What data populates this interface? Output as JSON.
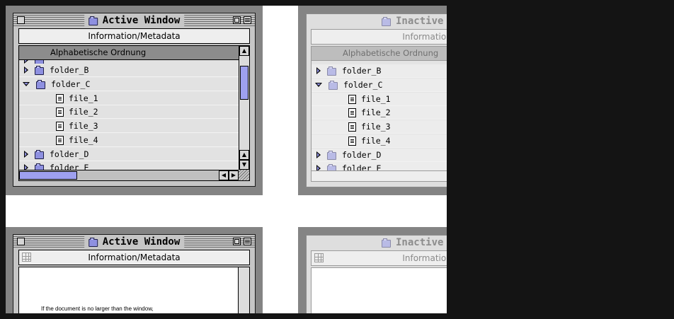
{
  "windows": {
    "active": {
      "title": "Active Window",
      "info_label": "Information/Metadata",
      "column_header": "Alphabetische Ordnung",
      "rows": [
        {
          "type": "folder",
          "label": "folder_B",
          "expanded": false
        },
        {
          "type": "folder",
          "label": "folder_C",
          "expanded": true
        },
        {
          "type": "file",
          "label": "file_1"
        },
        {
          "type": "file",
          "label": "file_2"
        },
        {
          "type": "file",
          "label": "file_3"
        },
        {
          "type": "file",
          "label": "file_4"
        },
        {
          "type": "folder",
          "label": "folder_D",
          "expanded": false
        },
        {
          "type": "folder",
          "label": "folder_E",
          "expanded": false
        }
      ]
    },
    "inactive": {
      "title": "Inactive Wi",
      "info_label": "Information/Meta",
      "column_header": "Alphabetische Ordnung",
      "rows": [
        {
          "type": "folder",
          "label": "folder_B",
          "expanded": false
        },
        {
          "type": "folder",
          "label": "folder_C",
          "expanded": true
        },
        {
          "type": "file",
          "label": "file_1"
        },
        {
          "type": "file",
          "label": "file_2"
        },
        {
          "type": "file",
          "label": "file_3"
        },
        {
          "type": "file",
          "label": "file_4"
        },
        {
          "type": "folder",
          "label": "folder_D",
          "expanded": false
        },
        {
          "type": "folder",
          "label": "folder_E",
          "expanded": false
        }
      ]
    },
    "active_doc": {
      "title": "Active Window",
      "info_label": "Information/Metadata",
      "doc_text": "If the document is no larger than the window,"
    },
    "inactive_doc": {
      "title": "Inactive Wi",
      "info_label": "Information/Meta"
    }
  },
  "colors": {
    "accent": "#9ea0ef",
    "folder": "#8e90e0",
    "window_gray": "#c6c6c6",
    "backdrop": "#848484"
  },
  "icons": [
    "folder-icon",
    "file-icon",
    "close-box-icon",
    "zoom-box-icon",
    "collapse-box-icon",
    "disclosure-triangle-icon",
    "grid-icon",
    "grow-box-icon"
  ]
}
